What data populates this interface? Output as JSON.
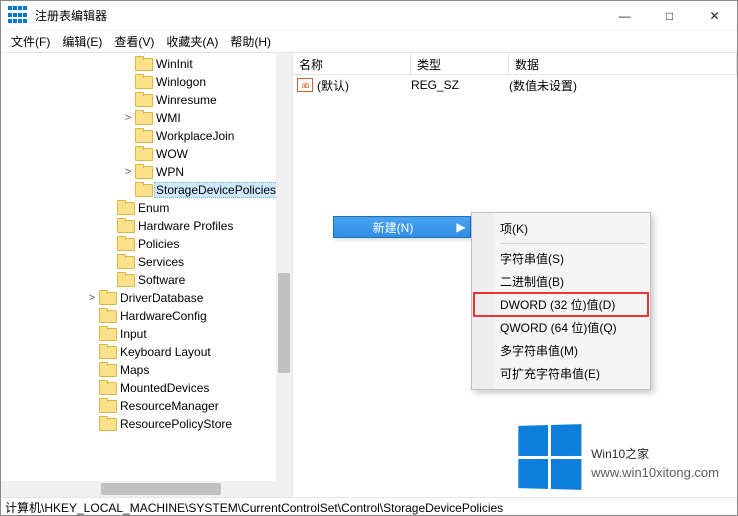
{
  "title": "注册表编辑器",
  "window": {
    "min": "—",
    "max": "□",
    "close": "✕"
  },
  "menubar": {
    "file": "文件(F)",
    "edit": "编辑(E)",
    "view": "查看(V)",
    "favorites": "收藏夹(A)",
    "help": "帮助(H)"
  },
  "columns": {
    "name": "名称",
    "type": "类型",
    "data": "数据"
  },
  "list": {
    "default_row": {
      "name": "(默认)",
      "type": "REG_SZ",
      "data": "(数值未设置)"
    }
  },
  "tree": {
    "items": [
      {
        "indent": 5,
        "exp": "",
        "label": "WinInit"
      },
      {
        "indent": 5,
        "exp": "",
        "label": "Winlogon"
      },
      {
        "indent": 5,
        "exp": "",
        "label": "Winresume"
      },
      {
        "indent": 5,
        "exp": ">",
        "label": "WMI"
      },
      {
        "indent": 5,
        "exp": "",
        "label": "WorkplaceJoin"
      },
      {
        "indent": 5,
        "exp": "",
        "label": "WOW"
      },
      {
        "indent": 5,
        "exp": ">",
        "label": "WPN"
      },
      {
        "indent": 5,
        "exp": "",
        "label": "StorageDevicePolicies",
        "selected": true
      },
      {
        "indent": 4,
        "exp": "",
        "label": "Enum"
      },
      {
        "indent": 4,
        "exp": "",
        "label": "Hardware Profiles"
      },
      {
        "indent": 4,
        "exp": "",
        "label": "Policies"
      },
      {
        "indent": 4,
        "exp": "",
        "label": "Services"
      },
      {
        "indent": 4,
        "exp": "",
        "label": "Software"
      },
      {
        "indent": 3,
        "exp": ">",
        "label": "DriverDatabase"
      },
      {
        "indent": 3,
        "exp": "",
        "label": "HardwareConfig"
      },
      {
        "indent": 3,
        "exp": "",
        "label": "Input"
      },
      {
        "indent": 3,
        "exp": "",
        "label": "Keyboard Layout"
      },
      {
        "indent": 3,
        "exp": "",
        "label": "Maps"
      },
      {
        "indent": 3,
        "exp": "",
        "label": "MountedDevices"
      },
      {
        "indent": 3,
        "exp": "",
        "label": "ResourceManager"
      },
      {
        "indent": 3,
        "exp": "",
        "label": "ResourcePolicyStore"
      }
    ]
  },
  "context": {
    "new_label": "新建(N)",
    "submenu": {
      "key": "项(K)",
      "string": "字符串值(S)",
      "binary": "二进制值(B)",
      "dword": "DWORD (32 位)值(D)",
      "qword": "QWORD (64 位)值(Q)",
      "multi": "多字符串值(M)",
      "expand": "可扩充字符串值(E)"
    }
  },
  "status": "计算机\\HKEY_LOCAL_MACHINE\\SYSTEM\\CurrentControlSet\\Control\\StorageDevicePolicies",
  "watermark": {
    "brand_a": "Win10",
    "brand_b": "之家",
    "url": "www.win10xitong.com"
  }
}
